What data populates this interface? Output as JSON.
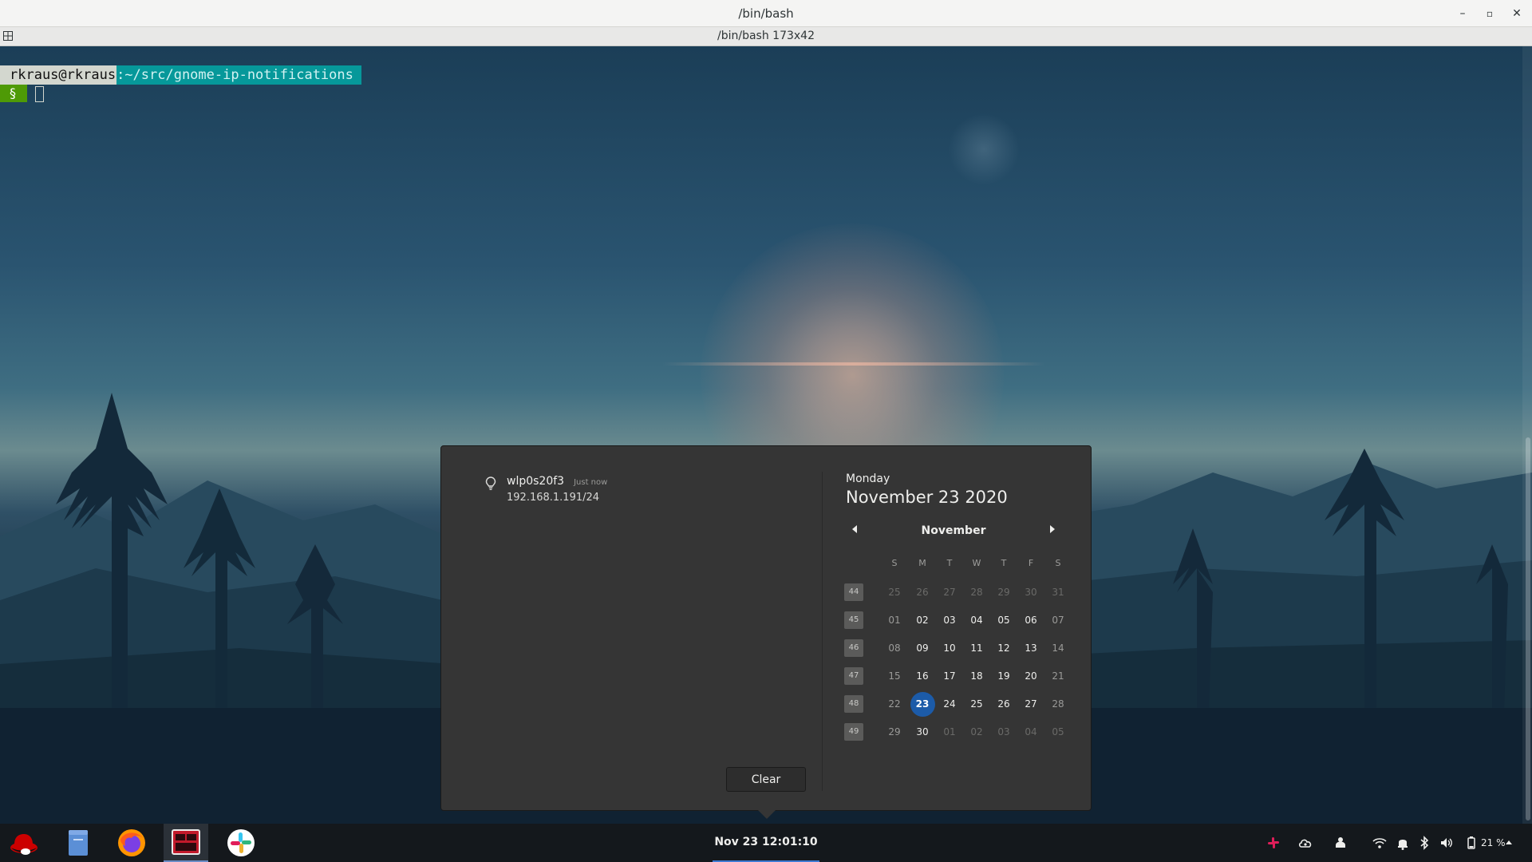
{
  "window": {
    "title": "/bin/bash",
    "tab_title": "/bin/bash 173x42",
    "minimize_glyph": "–",
    "maximize_glyph": "▫",
    "close_glyph": "✕"
  },
  "terminal": {
    "prompt_user": "rkraus@rkraus",
    "prompt_path": ":~/src/gnome-ip-notifications",
    "prompt_symbol": "§"
  },
  "notification": {
    "icon": "lightbulb-icon",
    "interface": "wlp0s20f3",
    "time": "Just now",
    "address": "192.168.1.191/24"
  },
  "clear_label": "Clear",
  "calendar": {
    "day_name": "Monday",
    "full_date": "November 23 2020",
    "month": "November",
    "weekdays": [
      "S",
      "M",
      "T",
      "W",
      "T",
      "F",
      "S"
    ],
    "weeks": [
      {
        "num": "44",
        "days": [
          "25",
          "26",
          "27",
          "28",
          "29",
          "30",
          "31"
        ]
      },
      {
        "num": "45",
        "days": [
          "01",
          "02",
          "03",
          "04",
          "05",
          "06",
          "07"
        ]
      },
      {
        "num": "46",
        "days": [
          "08",
          "09",
          "10",
          "11",
          "12",
          "13",
          "14"
        ]
      },
      {
        "num": "47",
        "days": [
          "15",
          "16",
          "17",
          "18",
          "19",
          "20",
          "21"
        ]
      },
      {
        "num": "48",
        "days": [
          "22",
          "23",
          "24",
          "25",
          "26",
          "27",
          "28"
        ]
      },
      {
        "num": "49",
        "days": [
          "29",
          "30",
          "01",
          "02",
          "03",
          "04",
          "05"
        ]
      }
    ],
    "today": "23",
    "today_color": "#1c5ba8"
  },
  "panel": {
    "clock": "Nov 23  12:01:10",
    "battery_percent": "21 %",
    "apps": [
      "redhat-icon",
      "files-icon",
      "firefox-icon",
      "terminal-icon",
      "slack-icon"
    ],
    "tray": [
      "slack-tray-icon",
      "cloud-icon",
      "keyboard-icon",
      "wifi-icon",
      "notification-bell-icon",
      "bluetooth-icon",
      "volume-icon",
      "battery-icon"
    ]
  }
}
